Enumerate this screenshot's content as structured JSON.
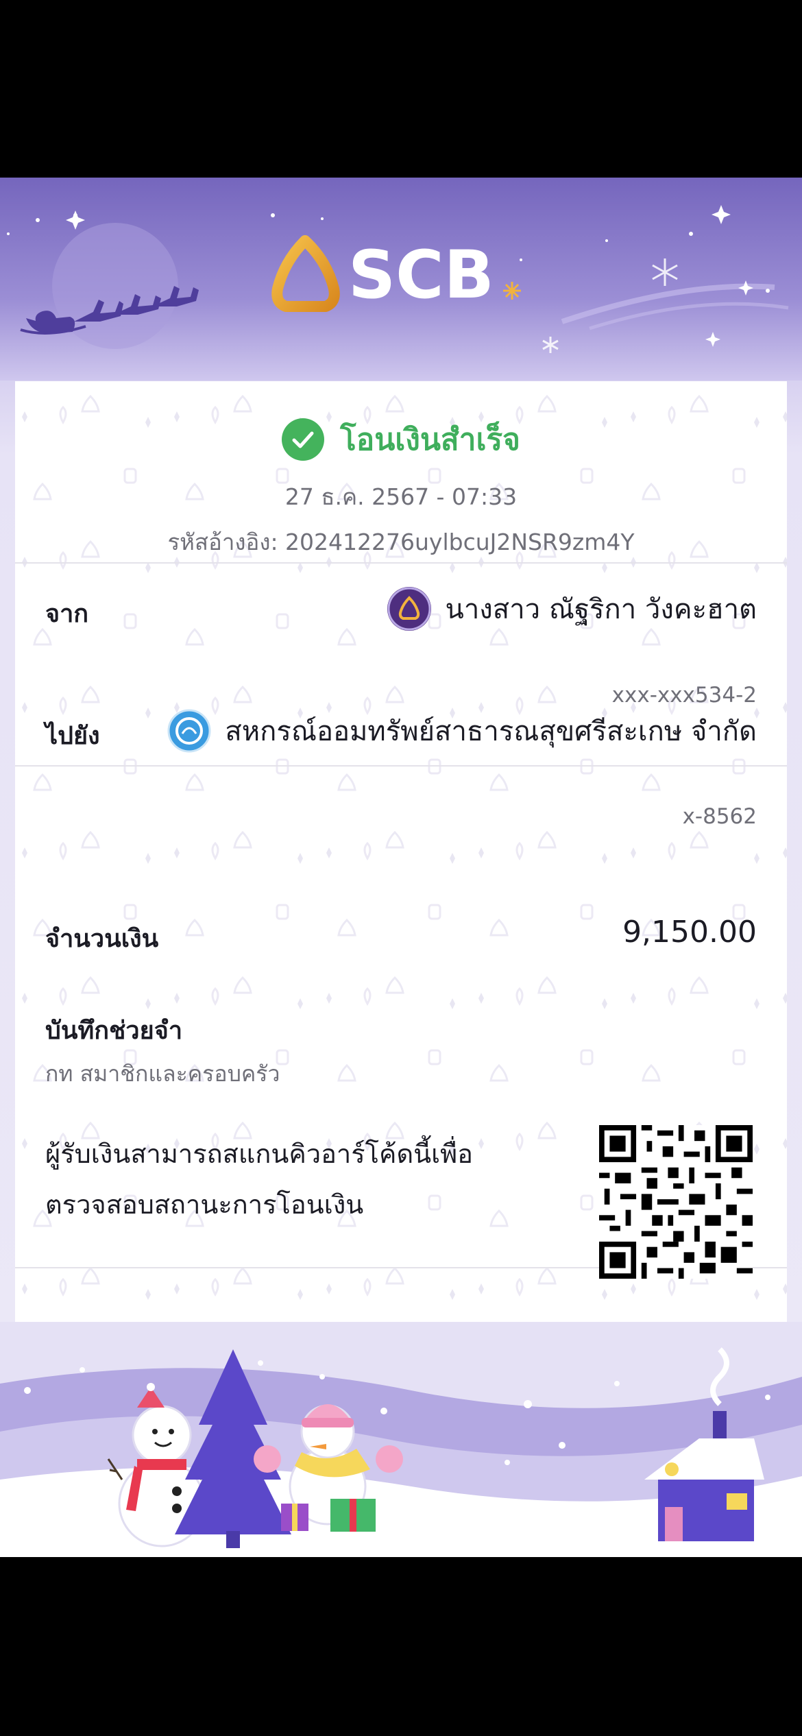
{
  "brand": {
    "name": "SCB",
    "primary_color": "#4e2e7f",
    "accent_color": "#f2b33d"
  },
  "status": {
    "title": "โอนเงินสำเร็จ",
    "datetime": "27 ธ.ค. 2567 - 07:33",
    "reference": "รหัสอ้างอิง: 202412276uylbcuJ2NSR9zm4Y",
    "color": "#3fae5c"
  },
  "from": {
    "label": "จาก",
    "name": "นางสาว ณัฐริกา วังคะฮาต",
    "account": "xxx-xxx534-2"
  },
  "to": {
    "label": "ไปยัง",
    "name": "สหกรณ์ออมทรัพย์สาธารณสุขศรีสะเกษ จำกัด",
    "account": "x-8562"
  },
  "amount": {
    "label": "จำนวนเงิน",
    "value": "9,150.00"
  },
  "memo": {
    "label": "บันทึกช่วยจำ",
    "value": "กท สมาชิกและครอบครัว"
  },
  "qr_note": {
    "line1": "ผู้รับเงินสามารถสแกนคิวอาร์โค้ดนี้เพื่อ",
    "line2": "ตรวจสอบสถานะการโอนเงิน"
  },
  "icons": [
    "scb-logo-icon",
    "check-icon",
    "scb-avatar-icon",
    "krungthai-avatar-icon",
    "qr-code-icon",
    "santa-sleigh-icon",
    "snowflake-icon",
    "snowman-icon",
    "christmas-tree-icon",
    "house-icon"
  ]
}
